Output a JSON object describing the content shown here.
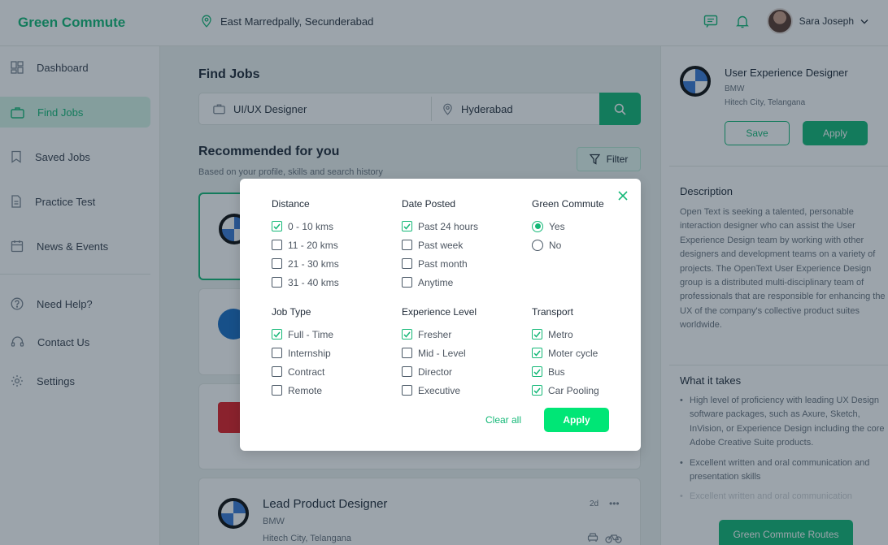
{
  "app": {
    "brand": "Green Commute"
  },
  "header": {
    "location": "East Marredpally, Secunderabad",
    "user_name": "Sara Joseph"
  },
  "sidebar": {
    "items": [
      {
        "label": "Dashboard",
        "icon": "dashboard-icon"
      },
      {
        "label": "Find Jobs",
        "icon": "briefcase-icon"
      },
      {
        "label": "Saved Jobs",
        "icon": "bookmark-icon"
      },
      {
        "label": "Practice Test",
        "icon": "document-icon"
      },
      {
        "label": "News & Events",
        "icon": "calendar-icon"
      },
      {
        "label": "Need Help?",
        "icon": "help-icon"
      },
      {
        "label": "Contact Us",
        "icon": "headset-icon"
      },
      {
        "label": "Settings",
        "icon": "gear-icon"
      }
    ],
    "active": "Find Jobs"
  },
  "main": {
    "title": "Find Jobs",
    "search": {
      "role_value": "UI/UX Designer",
      "location_value": "Hyderabad"
    },
    "recommended_title": "Recommended for you",
    "recommended_sub": "Based on your profile, skills and search history",
    "filter_label": "Filter",
    "visible_card": {
      "title": "Lead Product Designer",
      "company": "BMW",
      "location": "Hitech City, Telangana",
      "age": "2d",
      "more": "•••"
    }
  },
  "details": {
    "title": "User Experience Designer",
    "company": "BMW",
    "location": "Hitech City, Telangana",
    "save_label": "Save",
    "apply_label": "Apply",
    "description_heading": "Description",
    "description": "Open Text is seeking a talented, personable interaction designer who can assist the User Experience Design team by working with other designers and development teams on a variety of projects. The OpenText User Experience Design group is a distributed multi-disciplinary team of professionals that are responsible for enhancing the UX of the company's collective product suites worldwide.",
    "what_heading": "What it takes",
    "what_items": [
      "High level of proficiency with leading UX Design software packages, such as Axure, Sketch, InVision, or Experience Design including the core Adobe Creative Suite products.",
      "Excellent written and oral communication and presentation skills",
      "Excellent written and oral communication"
    ],
    "routes_label": "Green Commute Routes"
  },
  "filter_modal": {
    "distance": {
      "heading": "Distance",
      "options": [
        {
          "label": "0 - 10 kms",
          "checked": true
        },
        {
          "label": "11 - 20 kms",
          "checked": false
        },
        {
          "label": "21 - 30 kms",
          "checked": false
        },
        {
          "label": "31 - 40 kms",
          "checked": false
        }
      ]
    },
    "date_posted": {
      "heading": "Date Posted",
      "options": [
        {
          "label": "Past 24 hours",
          "checked": true
        },
        {
          "label": "Past week",
          "checked": false
        },
        {
          "label": "Past month",
          "checked": false
        },
        {
          "label": "Anytime",
          "checked": false
        }
      ]
    },
    "green_commute": {
      "heading": "Green Commute",
      "options": [
        {
          "label": "Yes",
          "selected": true
        },
        {
          "label": "No",
          "selected": false
        }
      ]
    },
    "job_type": {
      "heading": "Job Type",
      "options": [
        {
          "label": "Full - Time",
          "checked": true
        },
        {
          "label": "Internship",
          "checked": false
        },
        {
          "label": "Contract",
          "checked": false
        },
        {
          "label": "Remote",
          "checked": false
        }
      ]
    },
    "experience": {
      "heading": "Experience Level",
      "options": [
        {
          "label": "Fresher",
          "checked": true
        },
        {
          "label": "Mid - Level",
          "checked": false
        },
        {
          "label": "Director",
          "checked": false
        },
        {
          "label": "Executive",
          "checked": false
        }
      ]
    },
    "transport": {
      "heading": "Transport",
      "options": [
        {
          "label": "Metro",
          "checked": true
        },
        {
          "label": "Moter cycle",
          "checked": true
        },
        {
          "label": "Bus",
          "checked": true
        },
        {
          "label": "Car Pooling",
          "checked": true
        }
      ]
    },
    "clear_label": "Clear all",
    "apply_label": "Apply"
  },
  "colors": {
    "accent": "#14b877",
    "apply_bright": "#00e676",
    "overlay": "rgba(18,38,55,0.42)"
  }
}
